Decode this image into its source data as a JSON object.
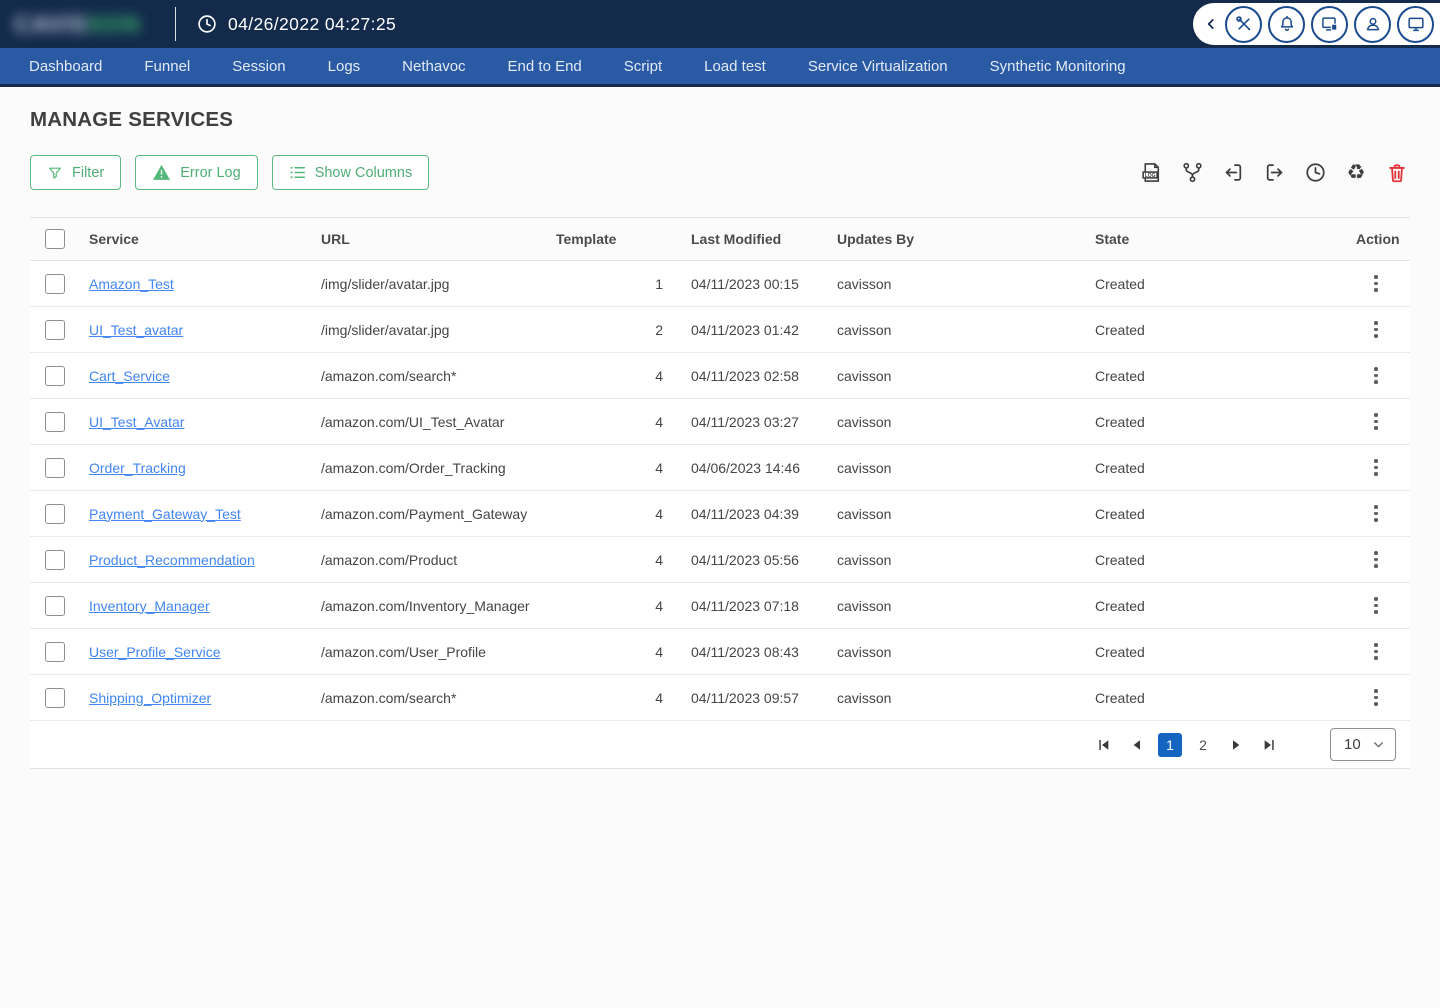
{
  "topbar": {
    "brand_left": "CAVIS",
    "brand_right": "SON",
    "timestamp": "04/26/2022 04:27:25",
    "icon_names": [
      "collapse-chevron",
      "tools",
      "notifications",
      "devices",
      "account",
      "display"
    ]
  },
  "nav": {
    "items": [
      "Dashboard",
      "Funnel",
      "Session",
      "Logs",
      "Nethavoc",
      "End to End",
      "Script",
      "Load test",
      "Service Virtualization",
      "Synthetic Monitoring"
    ]
  },
  "page_title": "MANAGE SERVICES",
  "buttons": {
    "filter": "Filter",
    "error_log": "Error Log",
    "show_columns": "Show Columns"
  },
  "toolbar": {
    "icons": [
      "log-report",
      "git-branch",
      "import",
      "export",
      "history",
      "recycle",
      "delete"
    ],
    "recycle_glyph": "♻"
  },
  "table": {
    "headers": {
      "service": "Service",
      "url": "URL",
      "template": "Template",
      "last_modified": "Last Modified",
      "updates_by": "Updates By",
      "state": "State",
      "action": "Action"
    },
    "rows": [
      {
        "service": "Amazon_Test",
        "url": "/img/slider/avatar.jpg",
        "template": "1",
        "last_modified": "04/11/2023 00:15",
        "updates_by": "cavisson",
        "state": "Created"
      },
      {
        "service": "UI_Test_avatar",
        "url": "/img/slider/avatar.jpg",
        "template": "2",
        "last_modified": "04/11/2023 01:42",
        "updates_by": "cavisson",
        "state": "Created"
      },
      {
        "service": "Cart_Service",
        "url": "/amazon.com/search*",
        "template": "4",
        "last_modified": "04/11/2023 02:58",
        "updates_by": "cavisson",
        "state": "Created"
      },
      {
        "service": "UI_Test_Avatar",
        "url": "/amazon.com/UI_Test_Avatar",
        "template": "4",
        "last_modified": "04/11/2023 03:27",
        "updates_by": "cavisson",
        "state": "Created"
      },
      {
        "service": "Order_Tracking",
        "url": "/amazon.com/Order_Tracking",
        "template": "4",
        "last_modified": "04/06/2023 14:46",
        "updates_by": "cavisson",
        "state": "Created"
      },
      {
        "service": "Payment_Gateway_Test",
        "url": "/amazon.com/Payment_Gateway",
        "template": "4",
        "last_modified": "04/11/2023 04:39",
        "updates_by": "cavisson",
        "state": "Created"
      },
      {
        "service": "Product_Recommendation",
        "url": "/amazon.com/Product",
        "template": "4",
        "last_modified": "04/11/2023 05:56",
        "updates_by": "cavisson",
        "state": "Created"
      },
      {
        "service": "Inventory_Manager",
        "url": "/amazon.com/Inventory_Manager",
        "template": "4",
        "last_modified": "04/11/2023 07:18",
        "updates_by": "cavisson",
        "state": "Created"
      },
      {
        "service": "User_Profile_Service",
        "url": "/amazon.com/User_Profile",
        "template": "4",
        "last_modified": "04/11/2023 08:43",
        "updates_by": "cavisson",
        "state": "Created"
      },
      {
        "service": "Shipping_Optimizer",
        "url": "/amazon.com/search*",
        "template": "4",
        "last_modified": "04/11/2023 09:57",
        "updates_by": "cavisson",
        "state": "Created"
      }
    ]
  },
  "pagination": {
    "page_1": "1",
    "page_2": "2",
    "active_page": "1",
    "page_size": "10"
  },
  "colors": {
    "topbar_bg": "#132A4B",
    "navbar_bg": "#2A5AA4",
    "accent_green": "#53B878",
    "link_blue": "#4285F4",
    "active_page_blue": "#1565C0",
    "delete_red": "#E3343B",
    "pill_icon_navy": "#1B4B8F"
  }
}
